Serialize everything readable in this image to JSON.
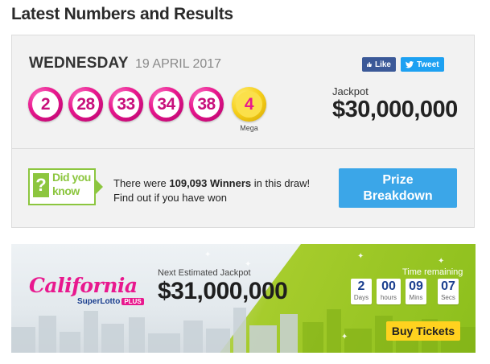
{
  "page": {
    "title": "Latest Numbers and Results"
  },
  "draw": {
    "day": "WEDNESDAY",
    "date": "19 APRIL 2017",
    "numbers": [
      "2",
      "28",
      "33",
      "34",
      "38"
    ],
    "mega_number": "4",
    "mega_label": "Mega",
    "jackpot_label": "Jackpot",
    "jackpot_value": "$30,000,000"
  },
  "social": {
    "like_label": "Like",
    "tweet_label": "Tweet"
  },
  "did_you_know": {
    "icon_text": "?",
    "line1": "Did you",
    "line2": "know",
    "winners_prefix": "There were ",
    "winners_count": "109,093 Winners",
    "winners_suffix": " in this draw!",
    "find_out": "Find out if you have won",
    "prize_button_line1": "Prize",
    "prize_button_line2": "Breakdown"
  },
  "banner": {
    "logo_main": "California",
    "logo_sub": "SuperLotto",
    "logo_plus": "PLUS",
    "next_label": "Next Estimated Jackpot",
    "next_value": "$31,000,000",
    "time_label": "Time remaining",
    "countdown": [
      {
        "value": "2",
        "unit": "Days"
      },
      {
        "value": "00",
        "unit": "hours"
      },
      {
        "value": "09",
        "unit": "Mins"
      },
      {
        "value": "07",
        "unit": "Secs"
      }
    ],
    "buy_label": "Buy Tickets"
  },
  "colors": {
    "ball_pink": "#e8188e",
    "mega_yellow": "#f6cf1a",
    "accent_green": "#8cc63f",
    "prize_blue": "#3ba6e8",
    "buy_yellow": "#ffd21f"
  }
}
